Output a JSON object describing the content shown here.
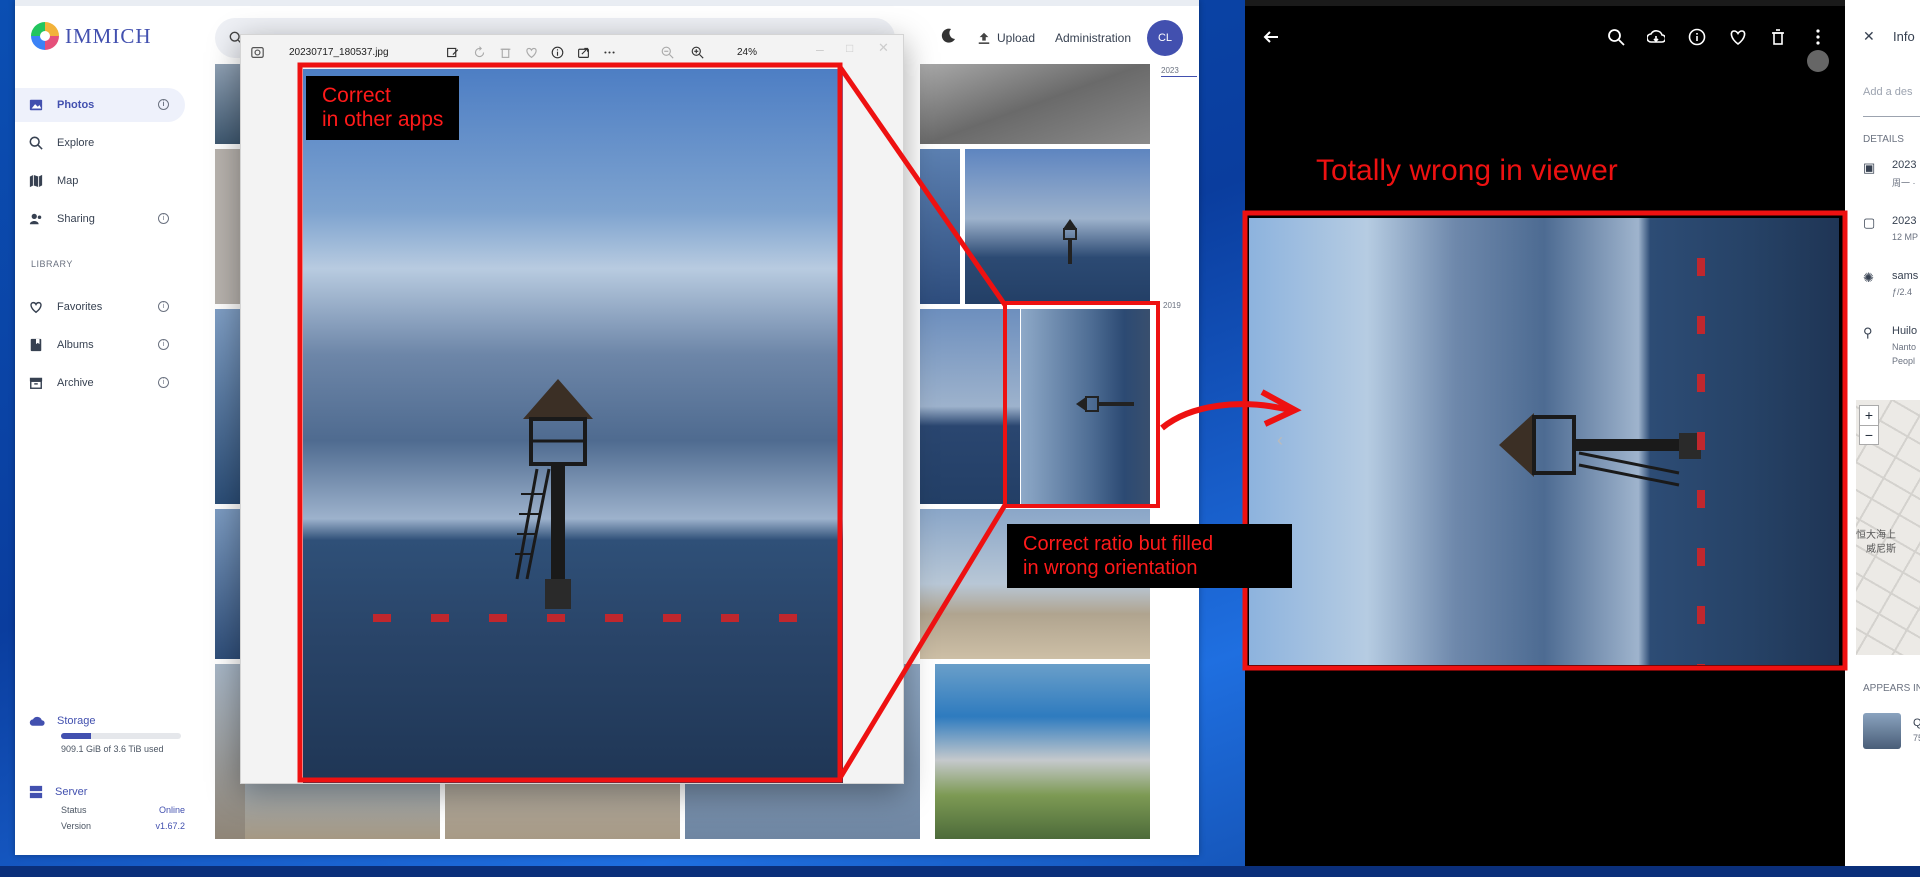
{
  "app": {
    "logo_text": "IMMICH",
    "header": {
      "upload_label": "Upload",
      "admin_label": "Administration",
      "avatar_initials": "CL"
    }
  },
  "sidebar": {
    "items": [
      {
        "label": "Photos",
        "icon": "photos-icon",
        "active": true
      },
      {
        "label": "Explore",
        "icon": "search-icon"
      },
      {
        "label": "Map",
        "icon": "map-icon"
      },
      {
        "label": "Sharing",
        "icon": "sharing-icon"
      }
    ],
    "library_label": "LIBRARY",
    "library_items": [
      {
        "label": "Favorites",
        "icon": "heart-icon"
      },
      {
        "label": "Albums",
        "icon": "album-icon"
      },
      {
        "label": "Archive",
        "icon": "archive-icon"
      }
    ],
    "storage": {
      "label": "Storage",
      "usage": "909.1 GiB of 3.6 TiB used",
      "used_fraction": 0.25
    },
    "server": {
      "label": "Server",
      "status_label": "Status",
      "status_value": "Online",
      "version_label": "Version",
      "version_value": "v1.67.2"
    }
  },
  "timeline": {
    "years": [
      "2023",
      "2019"
    ]
  },
  "photos_viewer": {
    "filename": "20230717_180537.jpg",
    "zoom": "24%"
  },
  "web_viewer": {
    "info_title": "Info",
    "description_placeholder": "Add a des",
    "details_label": "DETAILS",
    "detail_lines": [
      {
        "top": "2023",
        "bottom": "周一 ·"
      },
      {
        "top": "2023",
        "bottom": "12 MP"
      },
      {
        "top": "sams",
        "bottom": "ƒ/2.4"
      },
      {
        "top": "Huilo",
        "bottom": "Nanto"
      }
    ],
    "detail_extra": "Peopl",
    "appears_in_label": "APPEARS IN",
    "album_line1": "Q",
    "album_line2": "75",
    "map_plus": "+",
    "map_minus": "−",
    "map_text1": "恒大海上",
    "map_text2": "威尼斯"
  },
  "annotations": {
    "correct_other_apps": [
      "Correct",
      "in other apps"
    ],
    "totally_wrong": "Totally wrong in viewer",
    "correct_ratio": [
      "Correct ratio but filled",
      "in wrong orientation"
    ]
  },
  "colors": {
    "accent": "#4250af",
    "annotation_red": "#e11111"
  }
}
